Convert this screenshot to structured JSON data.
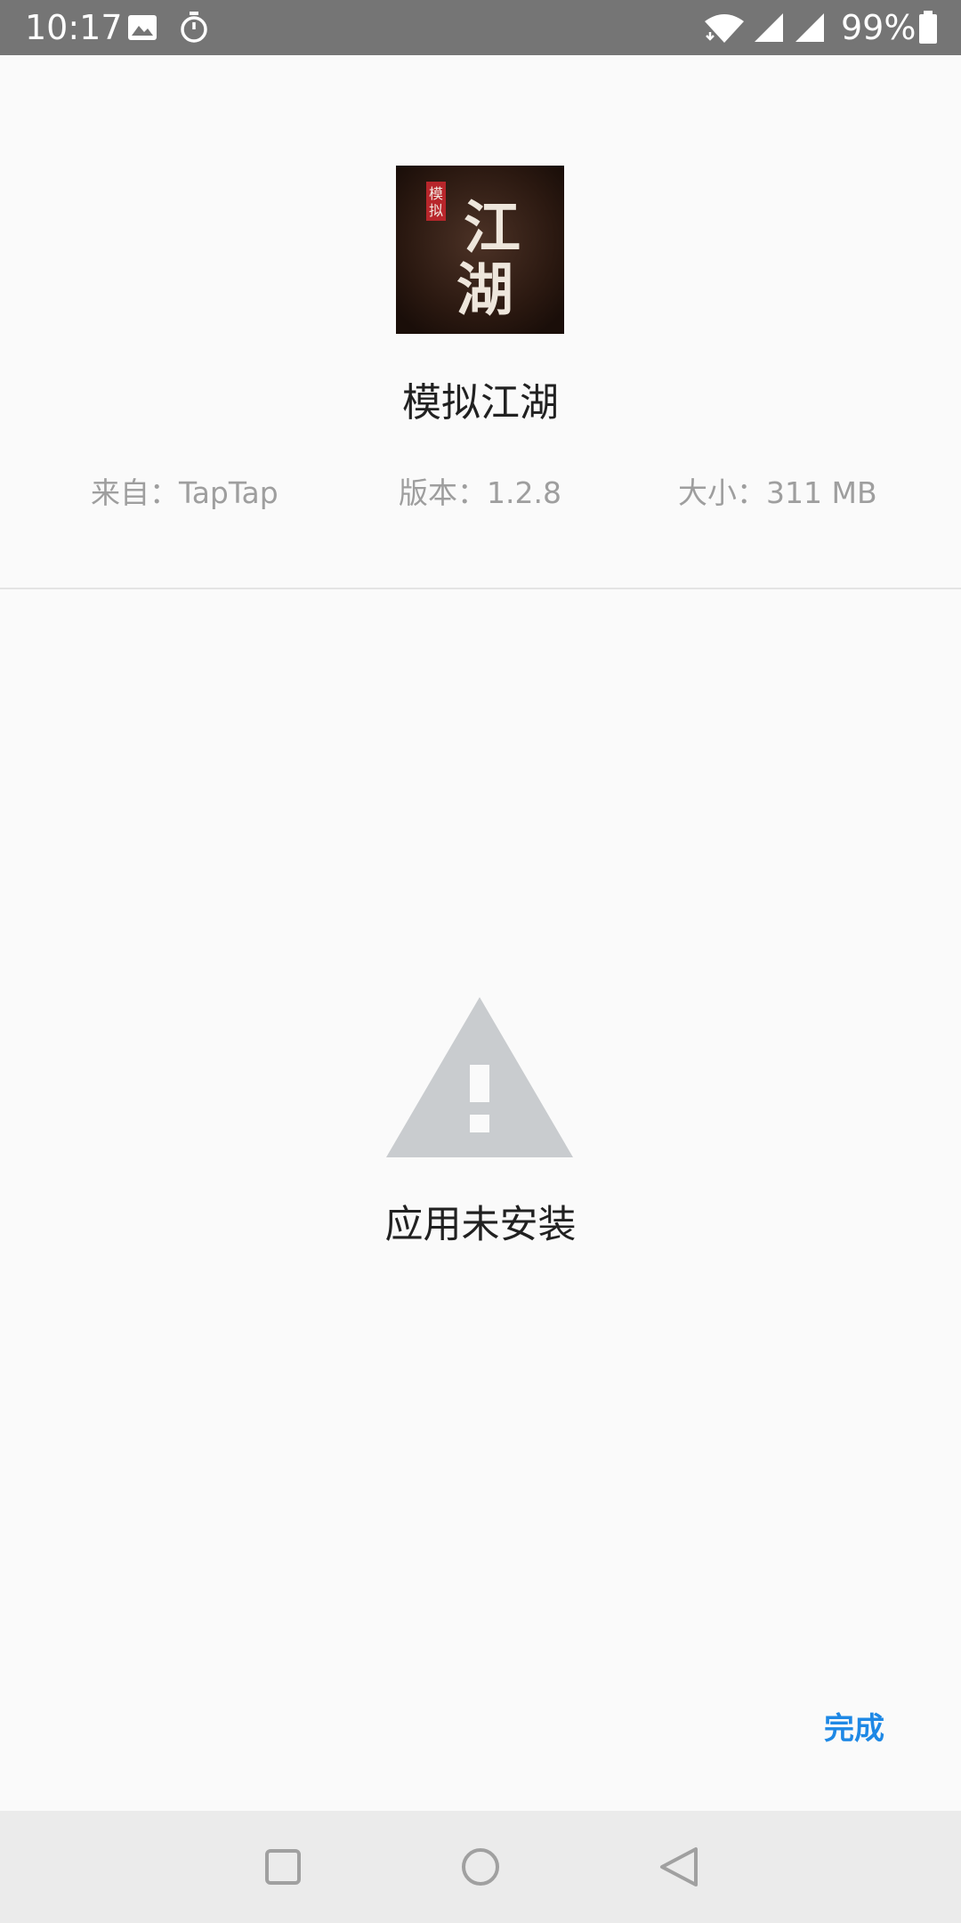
{
  "status_bar": {
    "time": "10:17",
    "battery_percent": "99%",
    "icons": [
      "image-icon",
      "timer-icon",
      "wifi-icon",
      "signal-icon",
      "signal-icon",
      "battery-icon"
    ]
  },
  "app": {
    "name": "模拟江湖",
    "icon_text_main": "江湖",
    "icon_text_seal": "模拟",
    "source": "来自：TapTap",
    "version": "版本：1.2.8",
    "size": "大小：311 MB"
  },
  "result": {
    "icon": "warning-icon",
    "message": "应用未安装"
  },
  "actions": {
    "done_label": "完成"
  },
  "nav_bar": {
    "buttons": [
      "recents-icon",
      "home-icon",
      "back-icon"
    ]
  },
  "colors": {
    "status_bar_bg": "#757575",
    "accent": "#1e88e5",
    "warning_icon": "#c9cccf",
    "nav_bar_bg": "#ebebeb",
    "page_bg": "#fafafa"
  }
}
